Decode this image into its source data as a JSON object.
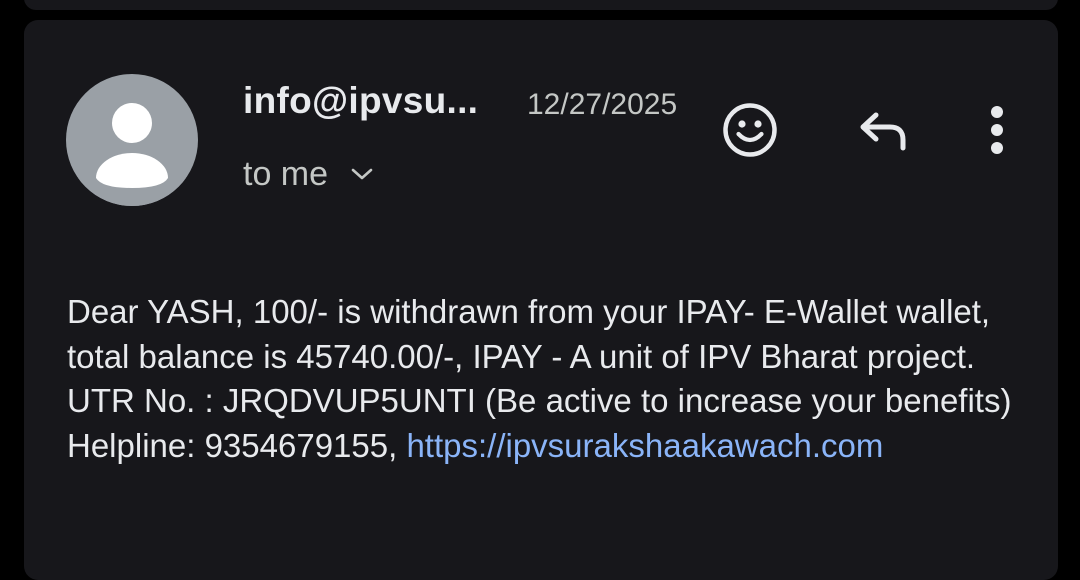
{
  "email": {
    "sender": "info@ipvsu...",
    "date": "12/27/2025",
    "recipient_label": "to me",
    "body": "Dear YASH, 100/- is withdrawn from your IPAY- E-Wallet wallet, total balance is 45740.00/-, IPAY - A unit of IPV Bharat project. UTR No. : JRQDVUP5UNTI (Be active to increase your benefits) Helpline: 9354679155,",
    "link": "https://ipvsurakshaakawach.com"
  },
  "icons": {
    "avatar": "person-avatar-icon",
    "expand": "chevron-down-icon",
    "reaction": "smiley-emoji-icon",
    "reply": "reply-arrow-icon",
    "more": "more-vertical-icon"
  },
  "colors": {
    "background": "#000000",
    "card": "#17171b",
    "text_primary": "#e8eaed",
    "text_secondary": "#c4c7c5",
    "link": "#8ab4f8",
    "avatar": "#9aa0a6"
  }
}
